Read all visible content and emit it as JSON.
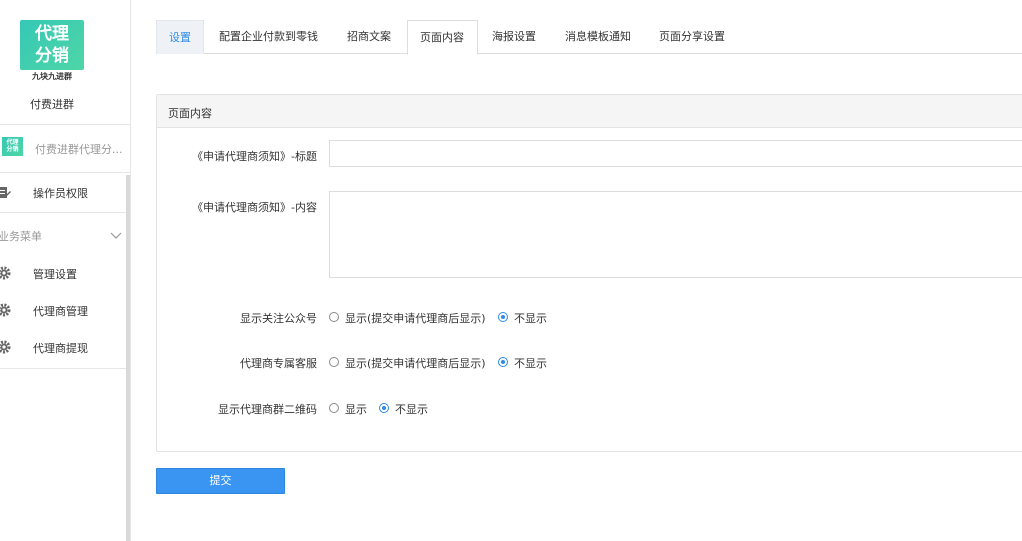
{
  "sidebar": {
    "logo_line1": "代理",
    "logo_line2": "分销",
    "logo_sub": "九块九进群",
    "app_name": "付费进群",
    "module_label": "付费进群代理分...",
    "mini_logo_line1": "代理",
    "mini_logo_line2": "分销",
    "operator_label": "操作员权限",
    "group_title": "业务菜单",
    "items": [
      {
        "label": "管理设置",
        "icon": "gear-icon"
      },
      {
        "label": "代理商管理",
        "icon": "gear-icon"
      },
      {
        "label": "代理商提现",
        "icon": "gear-icon"
      }
    ]
  },
  "tabs": [
    {
      "label": "设置"
    },
    {
      "label": "配置企业付款到零钱"
    },
    {
      "label": "招商文案"
    },
    {
      "label": "页面内容"
    },
    {
      "label": "海报设置"
    },
    {
      "label": "消息模板通知"
    },
    {
      "label": "页面分享设置"
    }
  ],
  "panel": {
    "title": "页面内容",
    "title_field_label": "《申请代理商须知》-标题",
    "title_field_value": "",
    "content_field_label": "《申请代理商须知》-内容",
    "content_field_value": "",
    "options": [
      {
        "label": "显示关注公众号",
        "choices": [
          "显示(提交申请代理商后显示)",
          "不显示"
        ],
        "selected": "不显示"
      },
      {
        "label": "代理商专属客服",
        "choices": [
          "显示(提交申请代理商后显示)",
          "不显示"
        ],
        "selected": "不显示"
      },
      {
        "label": "显示代理商群二维码",
        "choices": [
          "显示",
          "不显示"
        ],
        "selected": "不显示"
      }
    ]
  },
  "submit_label": "提交",
  "colors": {
    "accent": "#2f8bea",
    "button": "#3a95f2",
    "logo": "#35c8b6"
  }
}
